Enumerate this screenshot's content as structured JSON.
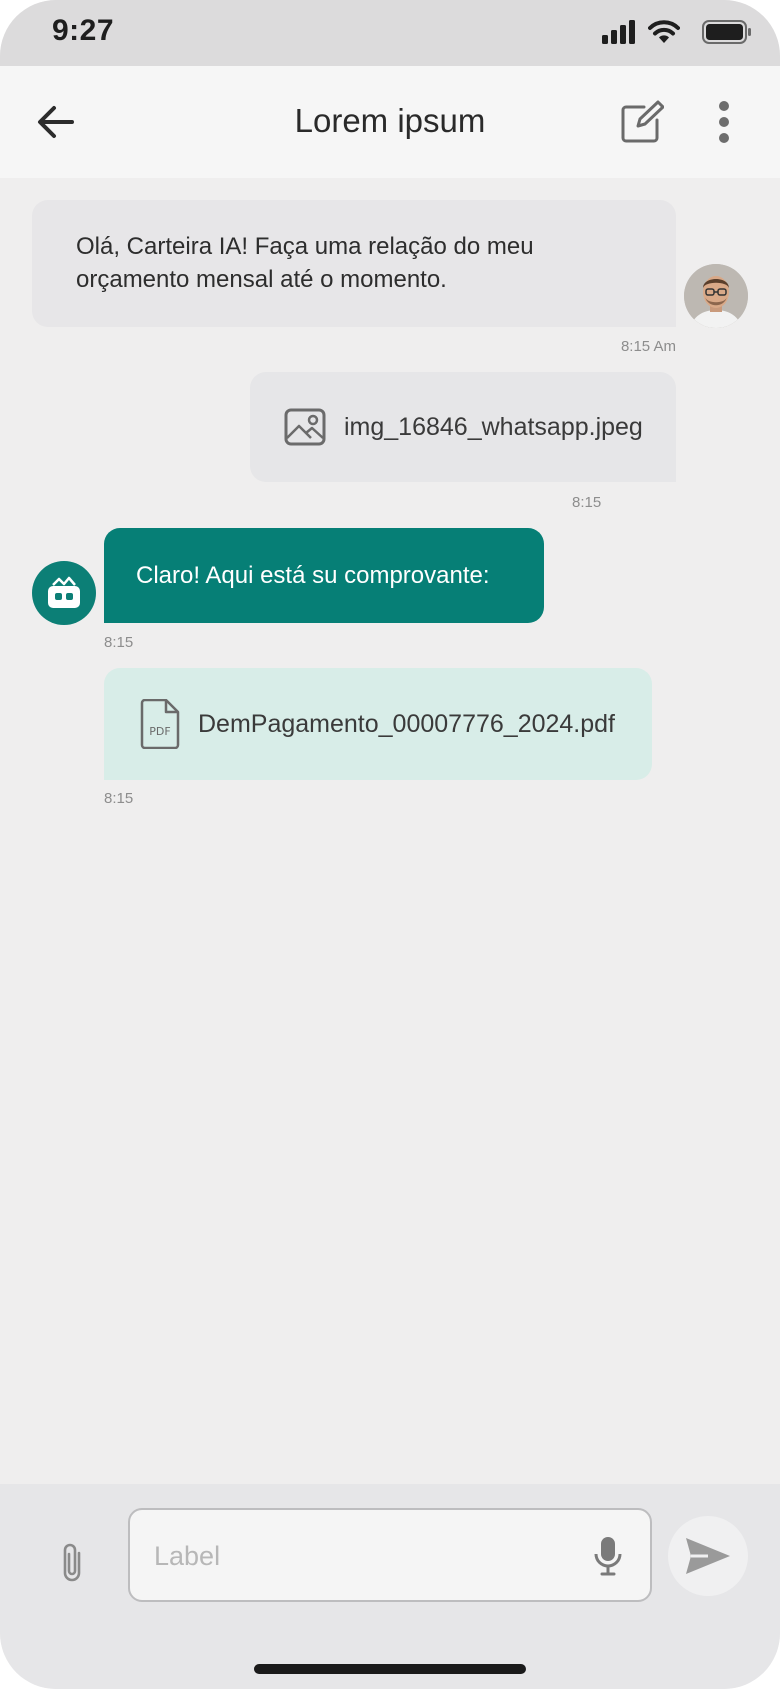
{
  "status_bar": {
    "time": "9:27"
  },
  "app_bar": {
    "title": "Lorem ipsum"
  },
  "messages": [
    {
      "sender": "user",
      "text": "Olá, Carteira IA! Faça uma relação do meu orçamento mensal até o momento.",
      "time": "8:15 Am"
    },
    {
      "sender": "user",
      "file_name": "img_16846_whatsapp.jpeg",
      "time": "8:15"
    },
    {
      "sender": "bot",
      "text": "Claro! Aqui está su comprovante:",
      "time": "8:15"
    },
    {
      "sender": "bot",
      "file_name": "DemPagamento_00007776_2024.pdf",
      "time": "8:15"
    }
  ],
  "composer": {
    "placeholder": "Label",
    "value": ""
  },
  "icons": {
    "back": "arrow-left-icon",
    "edit": "edit-icon",
    "more": "more-vertical-icon",
    "image": "image-icon",
    "pdf": "pdf-file-icon",
    "attach": "paperclip-icon",
    "mic": "microphone-icon",
    "send": "send-icon",
    "bot": "bot-wallet-icon"
  },
  "colors": {
    "accent": "#067f76",
    "bot_file_bubble": "#d8ede8",
    "user_bubble": "#e7e6e8",
    "background": "#efeeee"
  }
}
